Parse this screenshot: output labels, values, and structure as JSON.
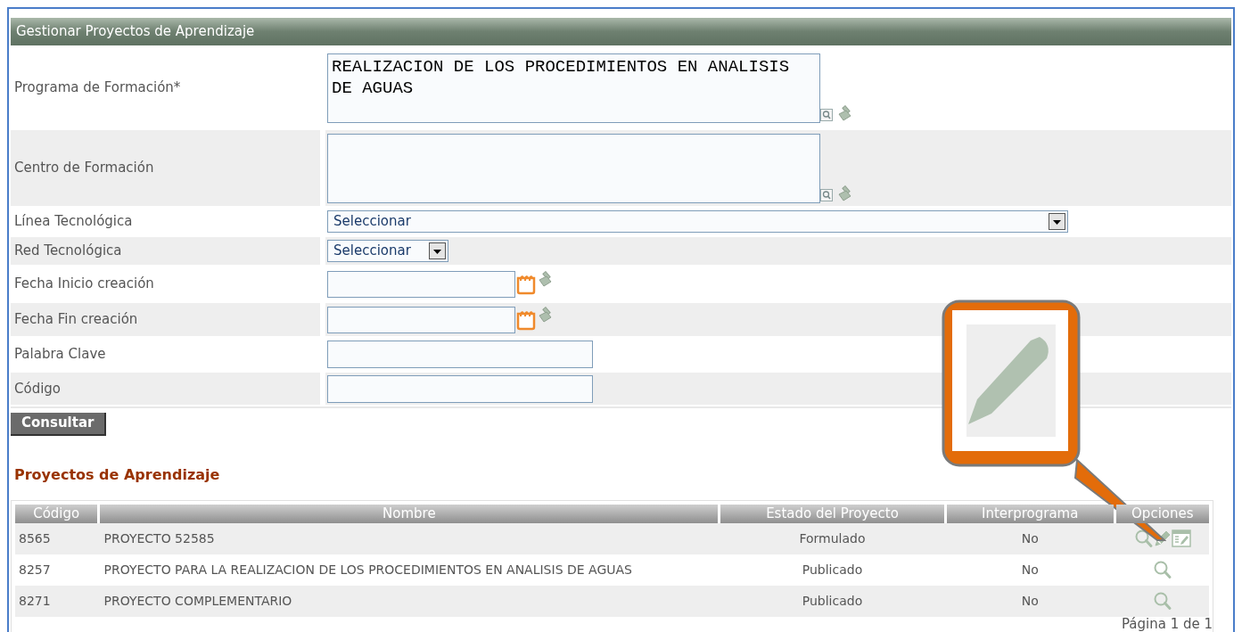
{
  "header": {
    "title": "Gestionar Proyectos de Aprendizaje"
  },
  "fields": [
    {
      "label": "Programa de Formación*",
      "kind": "textarea",
      "value": "REALIZACION DE LOS PROCEDIMIENTOS EN ANALISIS DE AGUAS"
    },
    {
      "label": "Centro de Formación",
      "kind": "textarea"
    },
    {
      "label": "Línea Tecnológica",
      "kind": "select-wide",
      "value": "Seleccionar"
    },
    {
      "label": "Red Tecnológica",
      "kind": "select",
      "value": "Seleccionar"
    },
    {
      "label": "Fecha Inicio creación",
      "kind": "date"
    },
    {
      "label": "Fecha Fin creación",
      "kind": "date"
    },
    {
      "label": "Palabra Clave",
      "kind": "text"
    },
    {
      "label": "Código",
      "kind": "text"
    }
  ],
  "search_button": "Consultar",
  "results": {
    "title": "Proyectos de Aprendizaje",
    "columns": [
      "Código",
      "Nombre",
      "Estado del Proyecto",
      "Interprograma",
      "Opciones"
    ],
    "rows": [
      {
        "cells": [
          "8565",
          "PROYECTO 52585",
          "Formulado",
          "No"
        ],
        "options": [
          {
            "kind": "view"
          },
          {
            "kind": "edit"
          },
          {
            "kind": "report"
          }
        ]
      },
      {
        "cells": [
          "8257",
          "PROYECTO PARA LA REALIZACION DE LOS PROCEDIMIENTOS EN ANALISIS DE AGUAS",
          "Publicado",
          "No"
        ],
        "options": [
          {
            "kind": "view"
          }
        ]
      },
      {
        "cells": [
          "8271",
          "PROYECTO COMPLEMENTARIO",
          "Publicado",
          "No"
        ],
        "options": [
          {
            "kind": "view"
          }
        ]
      }
    ],
    "pagination": "Página 1 de 1"
  }
}
